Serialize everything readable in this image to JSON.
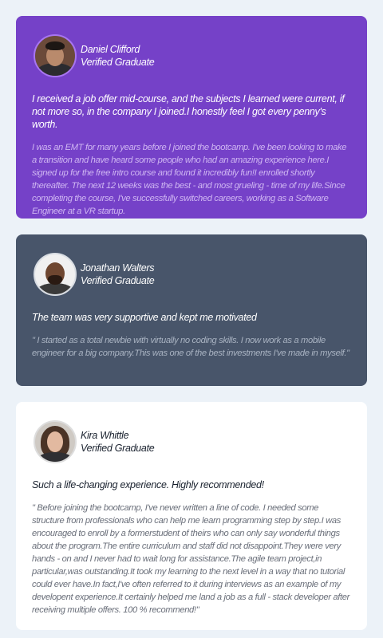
{
  "colors": {
    "page_background": "#ecf2f8",
    "card1_background": "#7541c8",
    "card2_background": "#48556a",
    "card3_background": "#ffffff",
    "card1_avatar_border": "#a775f1"
  },
  "testimonials": [
    {
      "avatar_icon": "person-photo-avatar",
      "name": "Daniel Clifford",
      "status": "Verified Graduate",
      "headline": "I received a job offer mid-course, and the subjects I learned were current, if not more so, in the company I joined.I honestly feel I got every penny's worth.",
      "body": "I was an EMT for many years before I joined the bootcamp. I've been looking to make a transition and have heard some people who had an amazing experience here.I signed up for the free intro course and found it incredibly fun!I enrolled shortly thereafter. The next 12 weeks was the best - and most grueling - time of my life.Since completing the course, I've successfully switched careers, working as a Software Engineer at a VR startup."
    },
    {
      "avatar_icon": "person-photo-avatar",
      "name": "Jonathan Walters",
      "status": "Verified Graduate",
      "headline": "The team was very supportive and kept me motivated",
      "body": "\" I started as a total newbie with virtually no coding skills. I now work as a mobile engineer for a big company.This was one of the best investments I've made in myself.\""
    },
    {
      "avatar_icon": "person-photo-avatar",
      "name": "Kira Whittle",
      "status": "Verified Graduate",
      "headline": "Such a life-changing experience. Highly recommended!",
      "body": "\" Before joining the bootcamp, I've never written a line of code. I needed some structure from professionals who can help me learn programming step by step.I was encouraged to enroll by a formerstudent of theirs who can only say wonderful things about the program.The entire curriculum and staff did not disappoint.They were very hands - on and I never had to wait long for assistance.The agile team project,in particular,was outstanding.It took my learning to the next level in a way that no tutorial could ever have.In fact,I've often referred to it during interviews as an example of my developent experience.It certainly helped me land a job as a full - stack developer after receiving multiple offers. 100 % recommend!\""
    }
  ]
}
